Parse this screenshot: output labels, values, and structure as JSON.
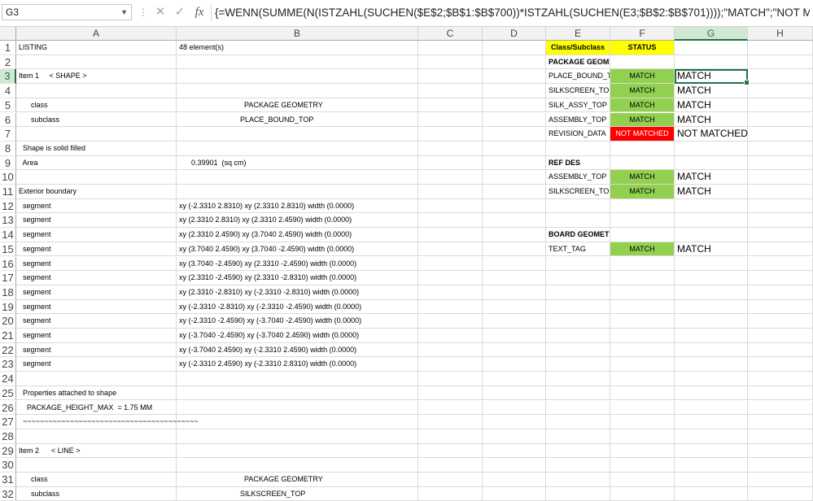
{
  "formula_bar": {
    "cell_ref": "G3",
    "formula": "{=WENN(SUMME(N(ISTZAHL(SUCHEN($E$2;$B$1:$B$700))*ISTZAHL(SUCHEN(E3;$B$2:$B$701))));\"MATCH\";\"NOT MATCHED\")}",
    "cancel_icon": "cancel-icon",
    "enter_icon": "checkmark-icon",
    "fx_label": "fx"
  },
  "columns": [
    "A",
    "B",
    "C",
    "D",
    "E",
    "F",
    "G",
    "H"
  ],
  "selected_column": "G",
  "selected_row": 3,
  "rows": [
    {
      "n": "1",
      "A": "LISTING",
      "B": "48 element(s)",
      "E": "Class/Subclass",
      "F": "STATUS"
    },
    {
      "n": "2",
      "A": "",
      "B": "",
      "E": "PACKAGE GEOMETRY"
    },
    {
      "n": "3",
      "A": "Item 1     < SHAPE >",
      "B": "",
      "E": "PLACE_BOUND_TOP",
      "F": "MATCH",
      "G": "MATCH"
    },
    {
      "n": "4",
      "A": "",
      "B": "",
      "E": "SILKSCREEN_TOP",
      "F": "MATCH",
      "G": "MATCH"
    },
    {
      "n": "5",
      "A": "      class",
      "B": "                                PACKAGE GEOMETRY",
      "E": "SILK_ASSY_TOP",
      "F": "MATCH",
      "G": "MATCH"
    },
    {
      "n": "6",
      "A": "      subclass",
      "B": "                              PLACE_BOUND_TOP",
      "E": "ASSEMBLY_TOP",
      "F": "MATCH",
      "G": "MATCH"
    },
    {
      "n": "7",
      "A": "",
      "B": "",
      "E": "REVISION_DATA",
      "F": "NOT MATCHED",
      "G": "NOT MATCHED"
    },
    {
      "n": "8",
      "A": "  Shape is solid filled",
      "B": ""
    },
    {
      "n": "9",
      "A": "  Area",
      "B": "      0.39901  (sq cm)",
      "E": "REF DES"
    },
    {
      "n": "10",
      "A": "",
      "B": "",
      "E": "ASSEMBLY_TOP",
      "F": "MATCH",
      "G": "MATCH"
    },
    {
      "n": "11",
      "A": "Exterior boundary",
      "B": "",
      "E": "SILKSCREEN_TOP",
      "F": "MATCH",
      "G": "MATCH"
    },
    {
      "n": "12",
      "A": "  segment",
      "B": "xy (-2.3310 2.8310) xy (2.3310 2.8310) width (0.0000)"
    },
    {
      "n": "13",
      "A": "  segment",
      "B": "xy (2.3310 2.8310) xy (2.3310 2.4590) width (0.0000)"
    },
    {
      "n": "14",
      "A": "  segment",
      "B": "xy (2.3310 2.4590) xy (3.7040 2.4590) width (0.0000)",
      "E": "BOARD GEOMETRY"
    },
    {
      "n": "15",
      "A": "  segment",
      "B": "xy (3.7040 2.4590) xy (3.7040 -2.4590) width (0.0000)",
      "E": "TEXT_TAG",
      "F": "MATCH",
      "G": "MATCH"
    },
    {
      "n": "16",
      "A": "  segment",
      "B": "xy (3.7040 -2.4590) xy (2.3310 -2.4590) width (0.0000)"
    },
    {
      "n": "17",
      "A": "  segment",
      "B": "xy (2.3310 -2.4590) xy (2.3310 -2.8310) width (0.0000)"
    },
    {
      "n": "18",
      "A": "  segment",
      "B": "xy (2.3310 -2.8310) xy (-2.3310 -2.8310) width (0.0000)"
    },
    {
      "n": "19",
      "A": "  segment",
      "B": "xy (-2.3310 -2.8310) xy (-2.3310 -2.4590) width (0.0000)"
    },
    {
      "n": "20",
      "A": "  segment",
      "B": "xy (-2.3310 -2.4590) xy (-3.7040 -2.4590) width (0.0000)"
    },
    {
      "n": "21",
      "A": "  segment",
      "B": "xy (-3.7040 -2.4590) xy (-3.7040 2.4590) width (0.0000)"
    },
    {
      "n": "22",
      "A": "  segment",
      "B": "xy (-3.7040 2.4590) xy (-2.3310 2.4590) width (0.0000)"
    },
    {
      "n": "23",
      "A": "  segment",
      "B": "xy (-2.3310 2.4590) xy (-2.3310 2.8310) width (0.0000)"
    },
    {
      "n": "24",
      "A": "",
      "B": ""
    },
    {
      "n": "25",
      "A": "  Properties attached to shape",
      "B": ""
    },
    {
      "n": "26",
      "A": "    PACKAGE_HEIGHT_MAX  = 1.75 MM",
      "B": ""
    },
    {
      "n": "27",
      "A": "  ~~~~~~~~~~~~~~~~~~~~~~~~~~~~~~~~~~~~~~~~~",
      "B": ""
    },
    {
      "n": "28",
      "A": "",
      "B": ""
    },
    {
      "n": "29",
      "A": "Item 2      < LINE >",
      "B": ""
    },
    {
      "n": "30",
      "A": "",
      "B": ""
    },
    {
      "n": "31",
      "A": "      class",
      "B": "                                PACKAGE GEOMETRY"
    },
    {
      "n": "32",
      "A": "      subclass",
      "B": "                              SILKSCREEN_TOP"
    }
  ],
  "colors": {
    "header_yellow": "#ffff00",
    "match_green": "#92d050",
    "not_matched_red": "#ff0000",
    "selection": "#217346"
  }
}
